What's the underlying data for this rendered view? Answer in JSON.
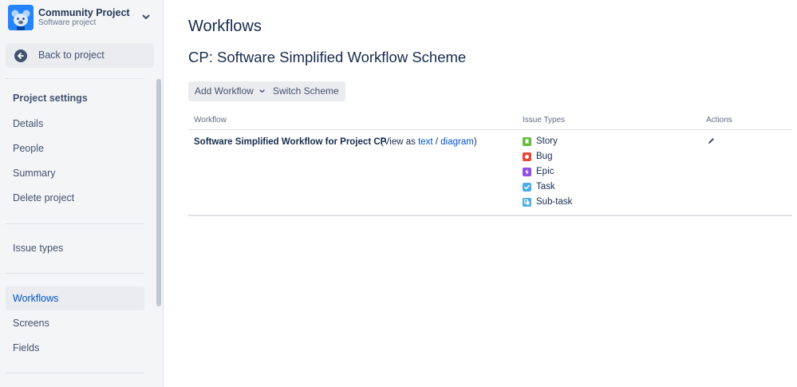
{
  "sidebar": {
    "project_name": "Community Project",
    "project_type": "Software project",
    "back_label": "Back to project",
    "section_title": "Project settings",
    "items": [
      {
        "label": "Details"
      },
      {
        "label": "People"
      },
      {
        "label": "Summary"
      },
      {
        "label": "Delete project"
      },
      {
        "label": "Issue types"
      },
      {
        "label": "Workflows"
      },
      {
        "label": "Screens"
      },
      {
        "label": "Fields"
      }
    ],
    "active_item": "Workflows"
  },
  "main": {
    "page_title": "Workflows",
    "scheme_title": "CP: Software Simplified Workflow Scheme",
    "add_workflow_label": "Add Workflow",
    "switch_scheme_label": "Switch Scheme",
    "table": {
      "headers": {
        "workflow": "Workflow",
        "issue_types": "Issue Types",
        "actions": "Actions"
      },
      "rows": [
        {
          "workflow_name": "Software Simplified Workflow for Project CP",
          "view_prefix": "(View as",
          "view_text_link": "text",
          "view_sep": "/",
          "view_diagram_link": "diagram",
          "view_suffix": ")",
          "issue_types": [
            {
              "name": "Story",
              "icon": "story-icon",
              "color": "#63ba3c"
            },
            {
              "name": "Bug",
              "icon": "bug-icon",
              "color": "#e5493a"
            },
            {
              "name": "Epic",
              "icon": "epic-icon",
              "color": "#904ee2"
            },
            {
              "name": "Task",
              "icon": "task-icon",
              "color": "#4bade8"
            },
            {
              "name": "Sub-task",
              "icon": "subtask-icon",
              "color": "#4bade8"
            }
          ],
          "action_icon": "edit-icon"
        }
      ]
    }
  },
  "colors": {
    "link": "#0052cc",
    "text": "#172b4d",
    "sidebar_bg": "#f4f5f7",
    "active_bg": "#ebecf0"
  }
}
